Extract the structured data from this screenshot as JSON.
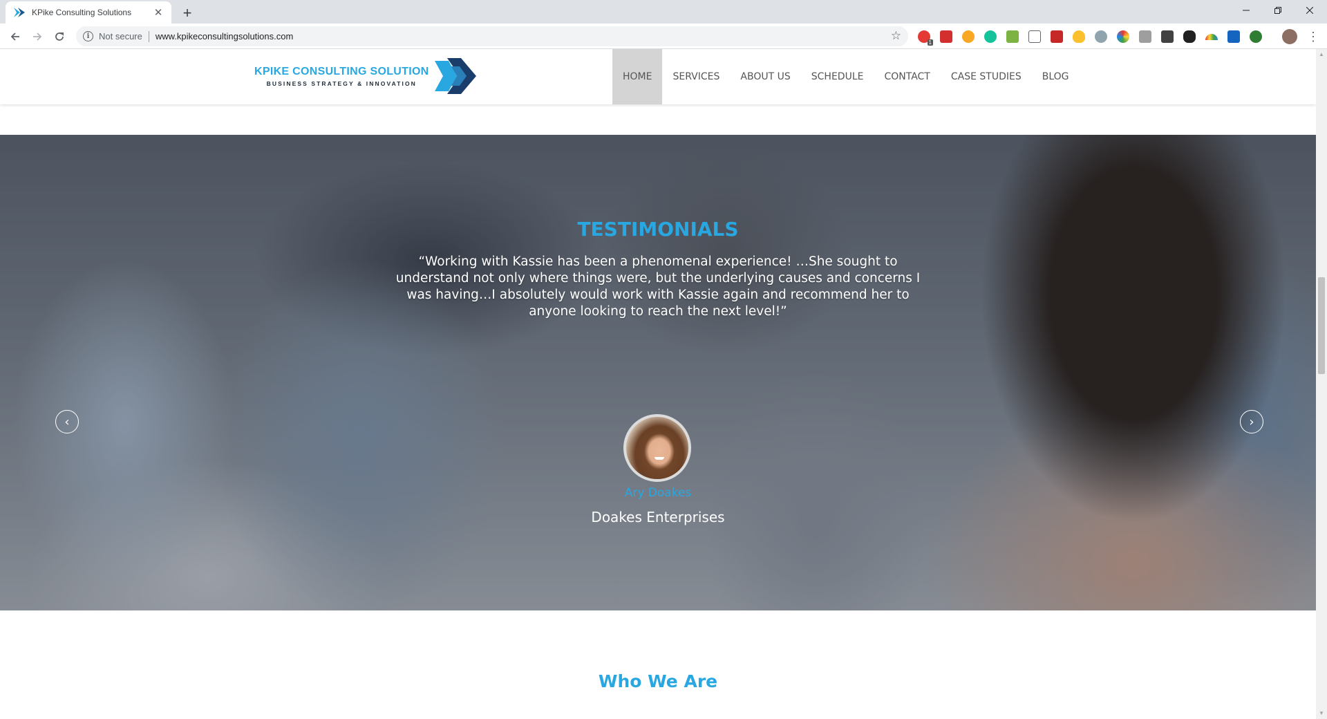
{
  "browser": {
    "tab_title": "KPike Consulting Solutions",
    "security_label": "Not secure",
    "url": "www.kpikeconsultingsolutions.com",
    "extension_badge": "1"
  },
  "site": {
    "logo": {
      "name": "KPIKE CONSULTING SOLUTION",
      "tagline": "BUSINESS STRATEGY & INNOVATION"
    },
    "nav": {
      "items": [
        {
          "label": "HOME",
          "active": true
        },
        {
          "label": "SERVICES"
        },
        {
          "label": "ABOUT US"
        },
        {
          "label": "SCHEDULE"
        },
        {
          "label": "CONTACT"
        },
        {
          "label": "CASE STUDIES"
        },
        {
          "label": "BLOG"
        }
      ]
    }
  },
  "testimonials": {
    "title": "TESTIMONIALS",
    "quote": "“Working with Kassie has been a phenomenal experience! …She sought to understand not only where things were, but the underlying causes and concerns I was having…I absolutely would work with Kassie again and recommend her to anyone looking to reach the next level!”",
    "person": "Ary Doakes",
    "company": "Doakes Enterprises",
    "prev_icon": "‹",
    "next_icon": "›"
  },
  "who_we_are": {
    "title": "Who We Are"
  },
  "colors": {
    "accent": "#29a7e1",
    "nav_active_bg": "#d4d4d4",
    "nav_text": "#555555"
  }
}
